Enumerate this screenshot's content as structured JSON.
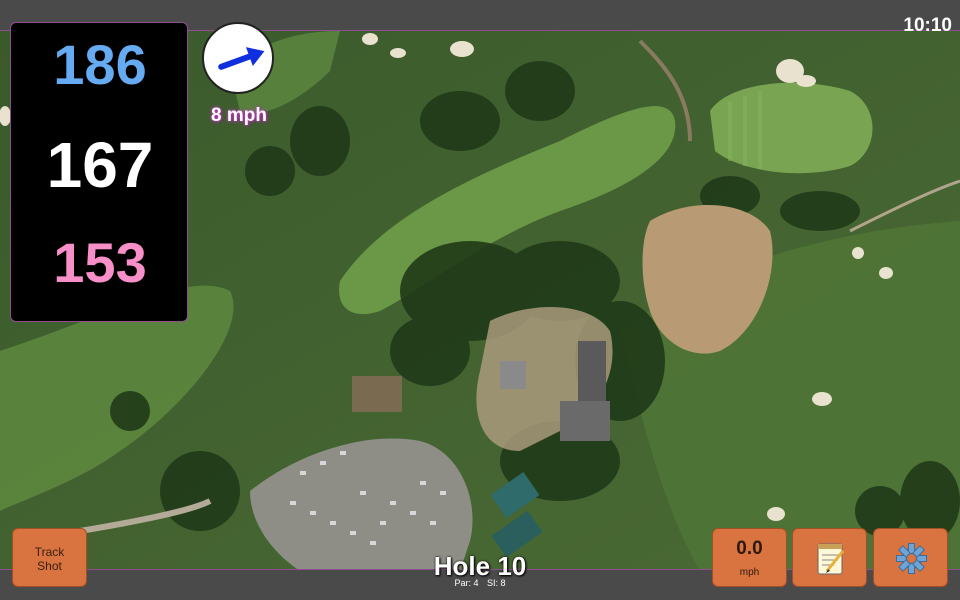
{
  "status": {
    "time": "10:10"
  },
  "distances": {
    "back": "186",
    "middle": "167",
    "front": "153"
  },
  "wind": {
    "speed": "8 mph",
    "direction_deg": 70
  },
  "hole": {
    "title": "Hole 10",
    "par": "Par: 4",
    "si": "SI: 8"
  },
  "buttons": {
    "track_shot": {
      "line1": "Track",
      "line2": "Shot"
    },
    "speed": {
      "value": "0.0",
      "unit": "mph"
    },
    "notes_icon": "notepad-icon",
    "settings_icon": "gear-icon"
  },
  "colors": {
    "back": "#66aaf2",
    "middle": "#ffffff",
    "front": "#f98fc8",
    "button": "#d9733f",
    "wind_arrow": "#1030e0"
  }
}
